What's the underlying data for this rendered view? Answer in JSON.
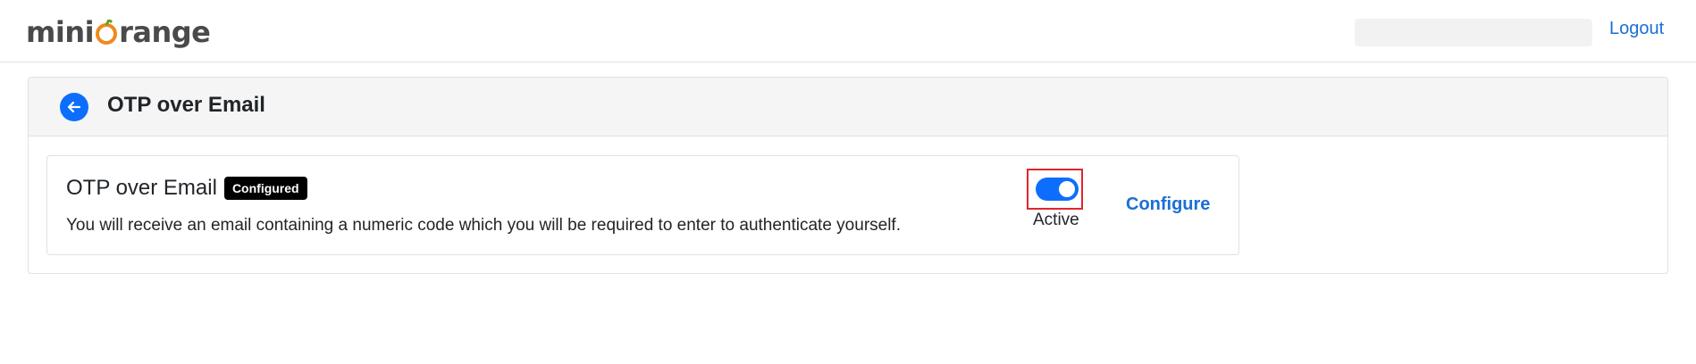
{
  "header": {
    "logo": {
      "prefix": "mini",
      "suffix": "range",
      "icon": "orange-o-logo-icon"
    },
    "logout_label": "Logout"
  },
  "card": {
    "back_icon": "arrow-left-icon",
    "title": "OTP over Email"
  },
  "method": {
    "title": "OTP over Email",
    "badge": "Configured",
    "description": "You will receive an email containing a numeric code which you will be required to enter to authenticate yourself.",
    "toggle_on": true,
    "status": "Active",
    "configure_label": "Configure"
  },
  "colors": {
    "accent": "#0d6efd",
    "link": "#1a6fd6",
    "brand_orange": "#ee8a1d",
    "highlight": "#e0262b"
  }
}
